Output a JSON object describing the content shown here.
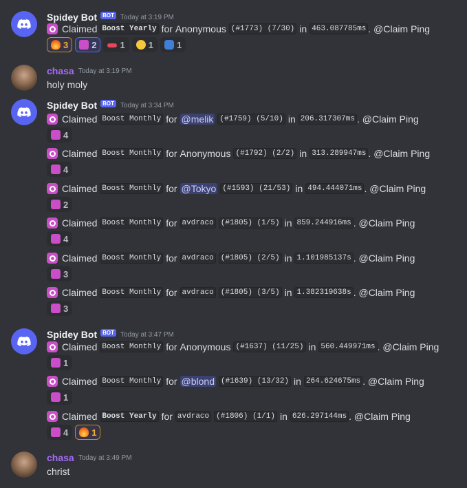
{
  "colors": {
    "bg": "#313338",
    "blurple": "#5865f2",
    "mention_bg": "#3c4270",
    "username_purple": "#a66cf7"
  },
  "messages": [
    {
      "author": "Spidey Bot",
      "bot_tag": "BOT",
      "timestamp": "Today at 3:19 PM",
      "lines": [
        {
          "claimed": "Claimed",
          "tier": "Boost Yearly",
          "for": "for",
          "target": "Anonymous",
          "target_is_mention": false,
          "id": "(#1773) (7/30)",
          "in": "in",
          "time": "463.087785ms",
          "ping": ". @Claim Ping",
          "reactions": [
            {
              "icon": "fire-emoji",
              "count": "3"
            },
            {
              "icon": "claim-emoji",
              "count": "2"
            },
            {
              "icon": "lips-emoji",
              "count": "1"
            },
            {
              "icon": "flushed-emoji",
              "count": "1"
            },
            {
              "icon": "mask-emoji",
              "count": "1"
            }
          ]
        }
      ]
    },
    {
      "author": "chasa",
      "timestamp": "Today at 3:19 PM",
      "text": "holy moly"
    },
    {
      "author": "Spidey Bot",
      "bot_tag": "BOT",
      "timestamp": "Today at 3:34 PM",
      "lines": [
        {
          "claimed": "Claimed",
          "tier": "Boost Monthly",
          "for": "for",
          "target": "@melik",
          "target_is_mention": true,
          "id": "(#1759) (5/10)",
          "in": "in",
          "time": "206.317307ms",
          "ping": ". @Claim Ping",
          "reactions": [
            {
              "icon": "claim-emoji",
              "count": "4"
            }
          ]
        },
        {
          "claimed": "Claimed",
          "tier": "Boost Monthly",
          "for": "for",
          "target": "Anonymous",
          "target_is_mention": false,
          "id": "(#1792) (2/2)",
          "in": "in",
          "time": "313.289947ms",
          "ping": ". @Claim Ping",
          "reactions": [
            {
              "icon": "claim-emoji",
              "count": "4"
            }
          ]
        },
        {
          "claimed": "Claimed",
          "tier": "Boost Monthly",
          "for": "for",
          "target": "@Tokyo",
          "target_is_mention": true,
          "id": "(#1593) (21/53)",
          "in": "in",
          "time": "494.444071ms",
          "ping": ". @Claim Ping",
          "reactions": [
            {
              "icon": "claim-emoji",
              "count": "2"
            }
          ]
        },
        {
          "claimed": "Claimed",
          "tier": "Boost Monthly",
          "for": "for",
          "target": "avdraco",
          "target_is_mention": false,
          "target_is_code": true,
          "id": "(#1805) (1/5)",
          "in": "in",
          "time": "859.244916ms",
          "ping": ". @Claim Ping",
          "reactions": [
            {
              "icon": "claim-emoji",
              "count": "4"
            }
          ]
        },
        {
          "claimed": "Claimed",
          "tier": "Boost Monthly",
          "for": "for",
          "target": "avdraco",
          "target_is_mention": false,
          "target_is_code": true,
          "id": "(#1805) (2/5)",
          "in": "in",
          "time": "1.101985137s",
          "ping": ". @Claim Ping",
          "reactions": [
            {
              "icon": "claim-emoji",
              "count": "3"
            }
          ]
        },
        {
          "claimed": "Claimed",
          "tier": "Boost Monthly",
          "for": "for",
          "target": "avdraco",
          "target_is_mention": false,
          "target_is_code": true,
          "id": "(#1805) (3/5)",
          "in": "in",
          "time": "1.382319638s",
          "ping": ". @Claim Ping",
          "reactions": [
            {
              "icon": "claim-emoji",
              "count": "3"
            }
          ]
        }
      ]
    },
    {
      "author": "Spidey Bot",
      "bot_tag": "BOT",
      "timestamp": "Today at 3:47 PM",
      "lines": [
        {
          "claimed": "Claimed",
          "tier": "Boost Monthly",
          "for": "for",
          "target": "Anonymous",
          "target_is_mention": false,
          "id": "(#1637) (11/25)",
          "in": "in",
          "time": "560.449971ms",
          "ping": ". @Claim Ping",
          "reactions": [
            {
              "icon": "claim-emoji",
              "count": "1"
            }
          ]
        },
        {
          "claimed": "Claimed",
          "tier": "Boost Monthly",
          "for": "for",
          "target": "@blond",
          "target_is_mention": true,
          "id": "(#1639) (13/32)",
          "in": "in",
          "time": "264.624675ms",
          "ping": ". @Claim Ping",
          "reactions": [
            {
              "icon": "claim-emoji",
              "count": "1"
            }
          ]
        },
        {
          "claimed": "Claimed",
          "tier": "Boost Yearly",
          "for": "for",
          "target": "avdraco",
          "target_is_mention": false,
          "target_is_code": true,
          "id": "(#1806) (1/1)",
          "in": "in",
          "time": "626.297144ms",
          "ping": ". @Claim Ping",
          "reactions": [
            {
              "icon": "claim-emoji",
              "count": "4"
            },
            {
              "icon": "fire-emoji",
              "count": "1"
            }
          ]
        }
      ]
    },
    {
      "author": "chasa",
      "timestamp": "Today at 3:49 PM",
      "text": "christ"
    }
  ]
}
